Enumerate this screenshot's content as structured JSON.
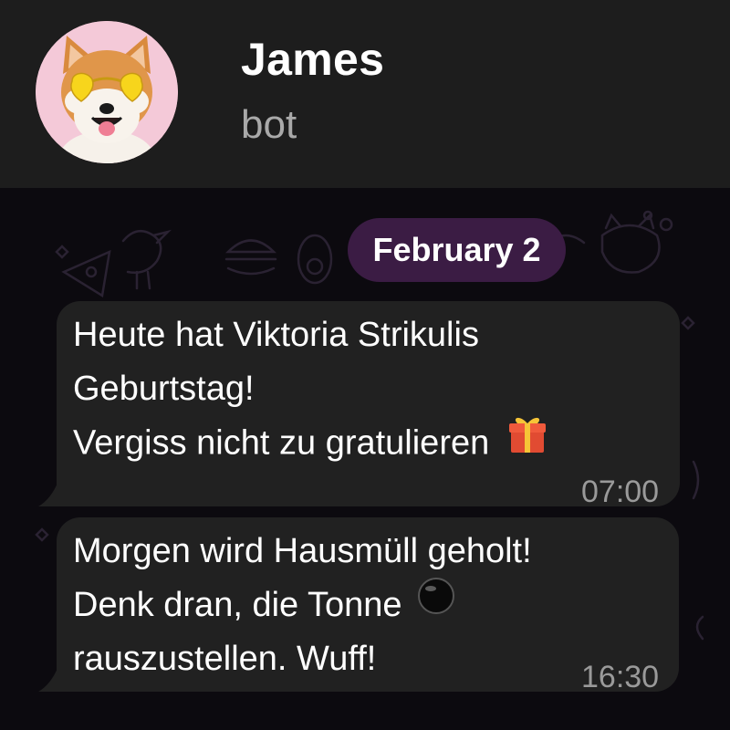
{
  "header": {
    "name": "James",
    "status": "bot"
  },
  "chat": {
    "date_chip": "February 2",
    "messages": [
      {
        "lines": [
          "Heute hat Viktoria Strikulis",
          "Geburtstag!",
          "Vergiss nicht zu gratulieren"
        ],
        "emoji": "gift-icon",
        "time": "07:00"
      },
      {
        "lines": [
          "Morgen wird Hausmüll geholt!",
          "Denk dran, die Tonne",
          "rauszustellen. Wuff!"
        ],
        "emoji": "black-circle-icon",
        "time": "16:30"
      }
    ]
  },
  "colors": {
    "header_bg": "#1d1d1d",
    "chat_bg": "#0c0a0f",
    "bubble_bg": "#212121",
    "date_chip_bg": "#3b1c44",
    "time_text": "#9a9a9a",
    "status_text": "#a9a9a9"
  }
}
